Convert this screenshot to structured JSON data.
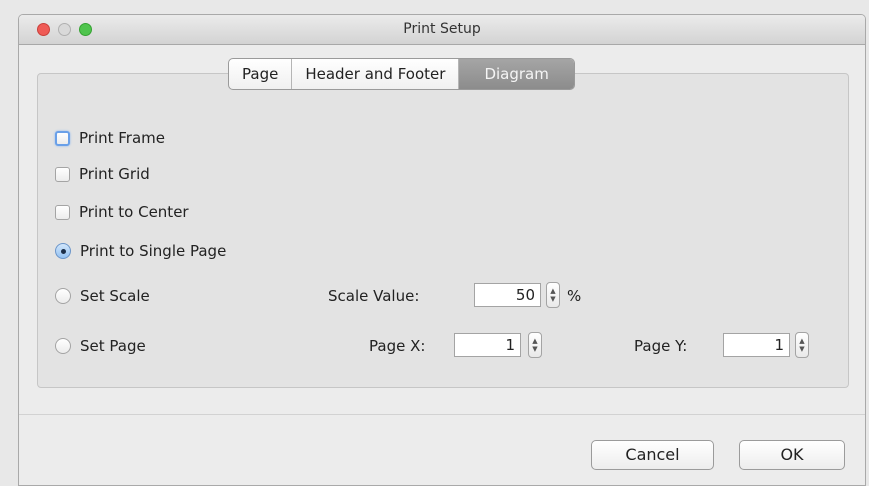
{
  "window": {
    "title": "Print Setup"
  },
  "tabs": [
    {
      "label": "Page"
    },
    {
      "label": "Header and Footer"
    },
    {
      "label": "Diagram",
      "active": true
    }
  ],
  "options": {
    "print_frame": {
      "label": "Print Frame",
      "checked": false,
      "focused": true
    },
    "print_grid": {
      "label": "Print Grid",
      "checked": false
    },
    "print_center": {
      "label": "Print to Center",
      "checked": false
    },
    "single_page": {
      "label": "Print to Single Page",
      "selected": true
    },
    "set_scale": {
      "label": "Set Scale",
      "selected": false
    },
    "set_page": {
      "label": "Set Page",
      "selected": false
    }
  },
  "scale": {
    "label": "Scale Value:",
    "value": "50",
    "unit": "%"
  },
  "page_x": {
    "label": "Page X:",
    "value": "1"
  },
  "page_y": {
    "label": "Page Y:",
    "value": "1"
  },
  "buttons": {
    "cancel": "Cancel",
    "ok": "OK"
  },
  "colors": {
    "focus_ring": "#6aa0e8",
    "active_tab": "#8c8c8c"
  }
}
